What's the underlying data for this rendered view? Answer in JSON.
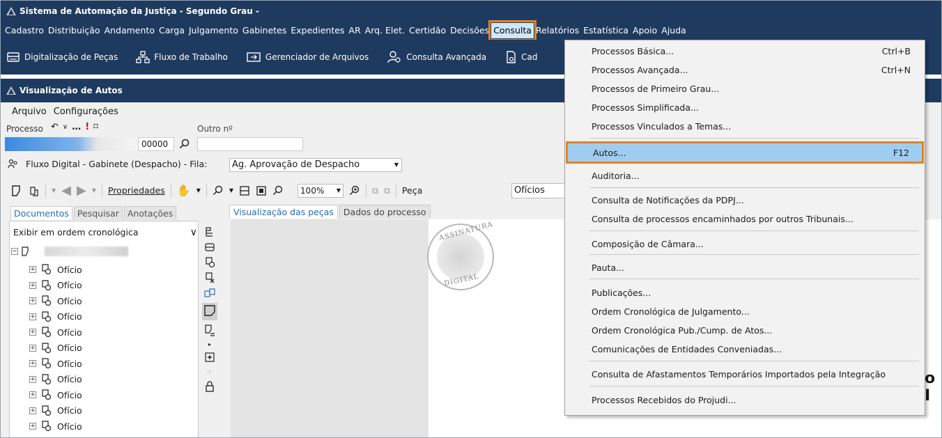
{
  "window_title": "Sistema de Automação da Justiça - Segundo Grau -",
  "menubar": {
    "items": [
      "Cadastro",
      "Distribuição",
      "Andamento",
      "Carga",
      "Julgamento",
      "Gabinetes",
      "Expedientes",
      "AR",
      "Arq. Elet.",
      "Certidão",
      "Decisões",
      "Consulta",
      "Relatórios",
      "Estatística",
      "Apoio",
      "Ajuda"
    ],
    "active": "Consulta"
  },
  "toolbar": {
    "digitalizacao": "Digitalização de Peças",
    "fluxo": "Fluxo de Trabalho",
    "gerenciador": "Gerenciador de Arquivos",
    "consulta_avancada": "Consulta Avançada",
    "cad": "Cad"
  },
  "inner_window": {
    "title": "Visualização de Autos",
    "menu_arquivo": "Arquivo",
    "menu_config": "Configurações",
    "processo_label": "Processo",
    "outro_label": "Outro nº",
    "processo_suffix": "00000",
    "fluxo_text": "Fluxo Digital - Gabinete (Despacho) - Fila:",
    "fila_value": "Ag. Aprovação de Despacho",
    "propriedades": "Propriedades",
    "zoom": "100%",
    "peca_label": "Peça",
    "peca_value": "Ofícios"
  },
  "left_tabs": [
    "Documentos",
    "Pesquisar",
    "Anotações"
  ],
  "order_select": "Exibir em ordem cronológica",
  "tree_items": [
    "Ofício",
    "Ofício",
    "Ofício",
    "Ofício",
    "Ofício",
    "Ofício",
    "Ofício",
    "Ofício",
    "Ofício",
    "Ofício",
    "Ofício"
  ],
  "right_tabs": [
    "Visualização das peças",
    "Dados do processo"
  ],
  "stamp": {
    "top": "ASSINATURA",
    "bottom": "DIGITAL"
  },
  "clipped_text": "o I",
  "consulta_menu": [
    {
      "label": "Processos Básica...",
      "shortcut": "Ctrl+B"
    },
    {
      "label": "Processos Avançada...",
      "shortcut": "Ctrl+N"
    },
    {
      "label": "Processos de Primeiro Grau...",
      "shortcut": ""
    },
    {
      "label": "Processos Simplificada...",
      "shortcut": ""
    },
    {
      "label": "Processos Vinculados a Temas...",
      "shortcut": ""
    },
    {
      "label": "Autos...",
      "shortcut": "F12"
    },
    {
      "label": "Auditoria...",
      "shortcut": ""
    },
    {
      "label": "Consulta de Notificações da PDPJ...",
      "shortcut": ""
    },
    {
      "label": "Consulta de processos encaminhados por outros Tribunais...",
      "shortcut": ""
    },
    {
      "label": "Composição de Câmara...",
      "shortcut": ""
    },
    {
      "label": "Pauta...",
      "shortcut": ""
    },
    {
      "label": "Publicações...",
      "shortcut": ""
    },
    {
      "label": "Ordem Cronológica de Julgamento...",
      "shortcut": ""
    },
    {
      "label": "Ordem Cronológica Pub./Cump. de Atos...",
      "shortcut": ""
    },
    {
      "label": "Comunicações de Entidades Conveniadas...",
      "shortcut": ""
    },
    {
      "label": "Consulta de Afastamentos Temporários Importados pela Integração",
      "shortcut": ""
    },
    {
      "label": "Processos Recebidos do Projudi...",
      "shortcut": ""
    }
  ],
  "colors": {
    "chrome": "#1e3a5f",
    "highlight": "#9fcdf1",
    "callout": "#e8821e"
  }
}
